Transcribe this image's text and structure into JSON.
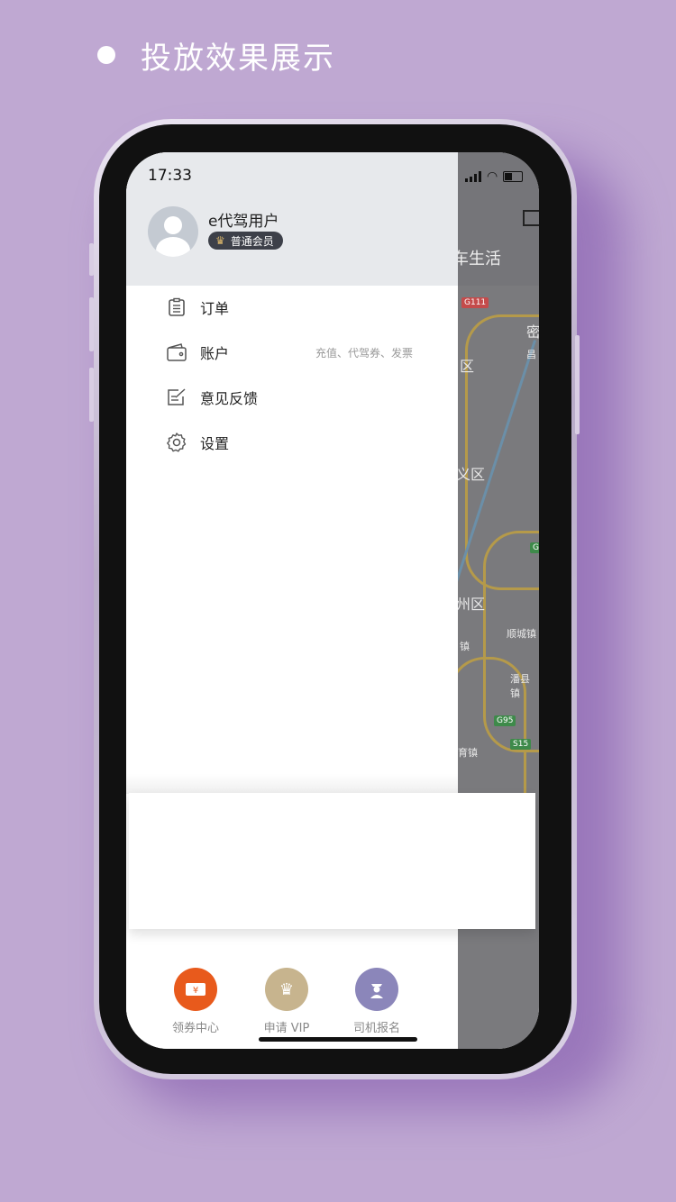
{
  "heading": {
    "title": "投放效果展示"
  },
  "status": {
    "time": "17:33"
  },
  "user": {
    "name": "e代驾用户",
    "badge": "普通会员"
  },
  "menu": [
    {
      "label": "订单",
      "icon": "list-icon",
      "hint": ""
    },
    {
      "label": "账户",
      "icon": "wallet-icon",
      "hint": "充值、代驾券、发票"
    },
    {
      "label": "意见反馈",
      "icon": "feedback-icon",
      "hint": ""
    },
    {
      "label": "设置",
      "icon": "gear-icon",
      "hint": ""
    }
  ],
  "map": {
    "header_text": "车生活",
    "labels": [
      "密",
      "区",
      "义区",
      "州区",
      "顺城镇",
      "镇",
      "育镇",
      "潘县镇",
      "昌"
    ],
    "shields": [
      "G111",
      "G95",
      "S15",
      "G"
    ]
  },
  "bottom_nav": [
    {
      "label": "领券中心",
      "icon": "coupon-icon",
      "color": "#e85a1c"
    },
    {
      "label": "申请 VIP",
      "icon": "crown-icon",
      "color": "#c7b48e"
    },
    {
      "label": "司机报名",
      "icon": "driver-icon",
      "color": "#8b86ba"
    }
  ],
  "colors": {
    "background": "#bfa8d2",
    "drawer_header": "#e7e9ec"
  }
}
